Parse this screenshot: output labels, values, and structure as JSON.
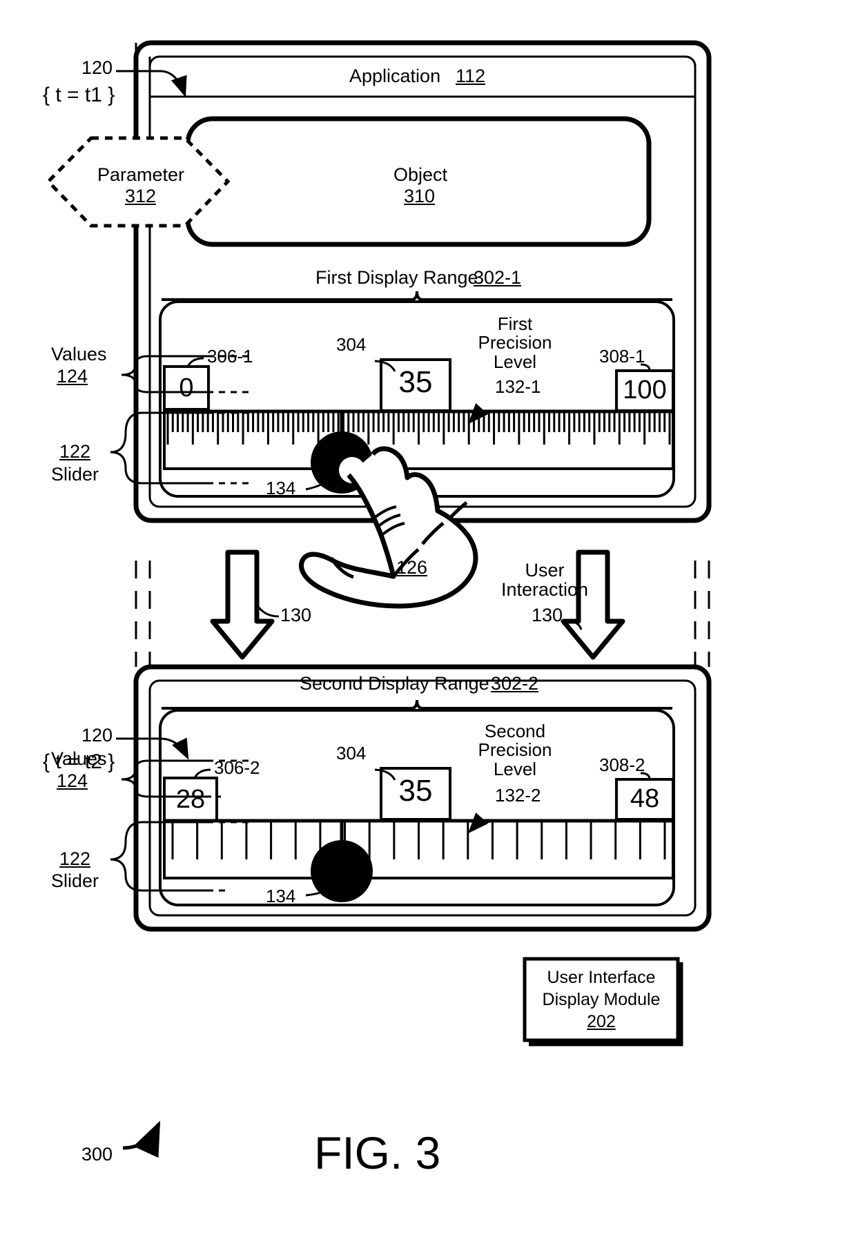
{
  "figure": {
    "label": "FIG. 3",
    "diagram_ref": "300"
  },
  "time_states": {
    "t1": "{ t = t1 }",
    "t2": "{ t = t2 }",
    "device_ref_1": "120",
    "device_ref_2": "120"
  },
  "application": {
    "title": "Application",
    "ref": "112"
  },
  "object": {
    "title": "Object",
    "ref": "310"
  },
  "parameter": {
    "title": "Parameter",
    "ref": "312"
  },
  "panel1": {
    "display_range_label": "First Display Range",
    "display_range_ref": "302-1",
    "precision_label_line1": "First",
    "precision_label_line2": "Precision",
    "precision_label_line3": "Level",
    "precision_ref": "132-1",
    "min_value": "0",
    "min_ref": "306-1",
    "current_value": "35",
    "current_ref": "304",
    "max_value": "100",
    "max_ref": "308-1",
    "thumb_ref": "134",
    "values_label": "Values",
    "values_ref": "124",
    "slider_ref": "122",
    "slider_label": "Slider",
    "tick_count": 101,
    "major_every": 5,
    "thumb_position_pct": 35
  },
  "panel2": {
    "display_range_label": "Second Display Range",
    "display_range_ref": "302-2",
    "precision_label_line1": "Second",
    "precision_label_line2": "Precision",
    "precision_label_line3": "Level",
    "precision_ref": "132-2",
    "min_value": "28",
    "min_ref": "306-2",
    "current_value": "35",
    "current_ref": "304",
    "max_value": "48",
    "max_ref": "308-2",
    "thumb_ref": "134",
    "values_label": "Values",
    "values_ref": "124",
    "slider_ref": "122",
    "slider_label": "Slider",
    "tick_count": 21,
    "thumb_position_pct": 35
  },
  "interaction": {
    "hand_ref": "126",
    "label_line1": "User",
    "label_line2": "Interaction",
    "arrow_ref_left": "130",
    "arrow_ref_right": "130"
  },
  "module": {
    "line1": "User Interface",
    "line2": "Display Module",
    "ref": "202"
  },
  "colors": {
    "stroke": "#000000",
    "background": "#ffffff"
  }
}
